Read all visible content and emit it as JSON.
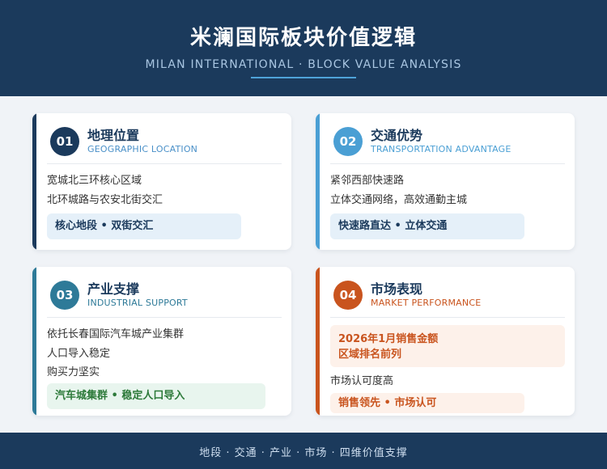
{
  "header": {
    "title": "米澜国际板块价值逻辑",
    "subtitle": "MILAN INTERNATIONAL · BLOCK VALUE ANALYSIS"
  },
  "cards": [
    {
      "number": "01",
      "title": "地理位置",
      "subtitle": "GEOGRAPHIC LOCATION",
      "lines": [
        "宽城北三环核心区域",
        "北环城路与农安北街交汇"
      ],
      "tag": "核心地段 • 双街交汇",
      "accent": "#1b3a5c"
    },
    {
      "number": "02",
      "title": "交通优势",
      "subtitle": "TRANSPORTATION ADVANTAGE",
      "lines": [
        "紧邻西部快速路",
        "立体交通网络，高效通勤主城"
      ],
      "tag": "快速路直达 • 立体交通",
      "accent": "#4a9fd4"
    },
    {
      "number": "03",
      "title": "产业支撑",
      "subtitle": "INDUSTRIAL SUPPORT",
      "lines": [
        "依托长春国际汽车城产业集群",
        "人口导入稳定",
        "购买力坚实"
      ],
      "tag": "汽车城集群 • 稳定人口导入",
      "accent": "#2e7a98"
    },
    {
      "number": "04",
      "title": "市场表现",
      "subtitle": "MARKET PERFORMANCE",
      "highlight": [
        "2026年1月销售金额",
        "区域排名前列"
      ],
      "lines": [
        "市场认可度高"
      ],
      "tag": "销售领先 • 市场认可",
      "accent": "#c9541e"
    }
  ],
  "footer": {
    "text": "地段 · 交通 · 产业 · 市场 · 四维价值支撑"
  }
}
